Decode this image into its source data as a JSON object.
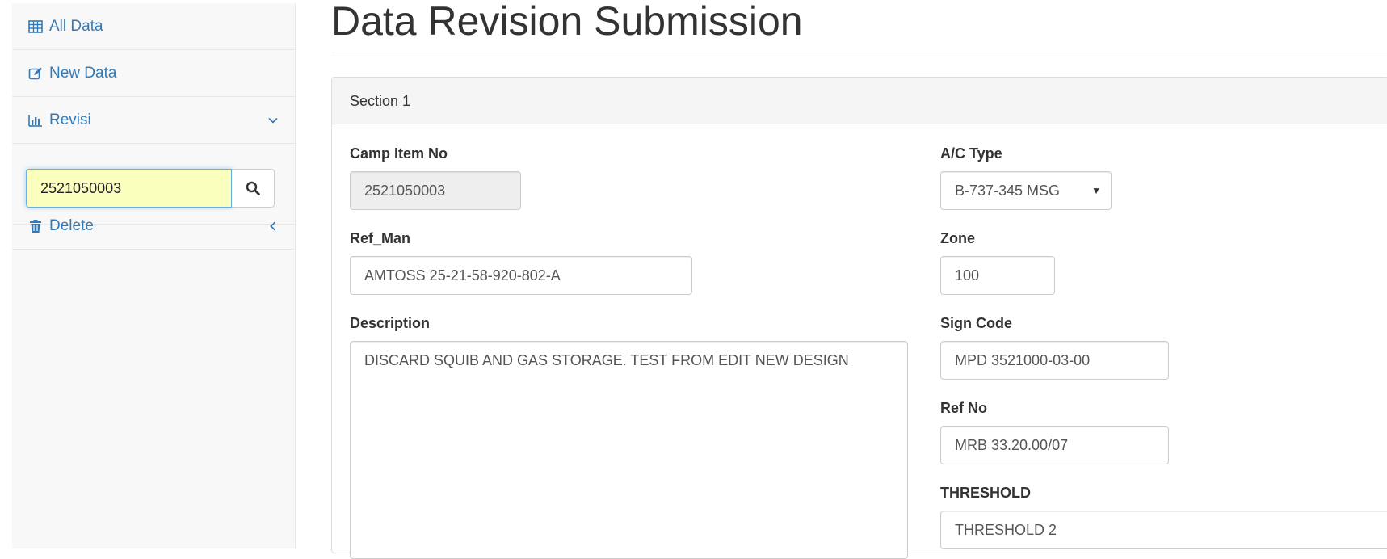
{
  "sidebar": {
    "items": [
      {
        "label": "All Data",
        "icon": "table-icon"
      },
      {
        "label": "New Data",
        "icon": "edit-icon"
      },
      {
        "label": "Revisi",
        "icon": "bar-chart-icon",
        "arrow": "chevron-down-icon"
      },
      {
        "label": "Delete",
        "icon": "trash-icon",
        "arrow": "chevron-left-icon"
      }
    ],
    "search": {
      "value": "2521050003",
      "button_icon": "search-icon"
    }
  },
  "page": {
    "title": "Data Revision Submission"
  },
  "panel": {
    "heading": "Section 1",
    "fields": {
      "camp_item_no": {
        "label": "Camp Item No",
        "value": "2521050003"
      },
      "ref_man": {
        "label": "Ref_Man",
        "value": "AMTOSS 25-21-58-920-802-A"
      },
      "description": {
        "label": "Description",
        "value": "DISCARD SQUIB AND GAS STORAGE. TEST FROM EDIT NEW DESIGN"
      },
      "ac_type": {
        "label": "A/C Type",
        "value": "B-737-345 MSG"
      },
      "zone": {
        "label": "Zone",
        "value": "100"
      },
      "sign_code": {
        "label": "Sign Code",
        "value": "MPD 3521000-03-00"
      },
      "ref_no": {
        "label": "Ref No",
        "value": "MRB 33.20.00/07"
      },
      "threshold": {
        "label": "THRESHOLD",
        "value": "THRESHOLD 2"
      }
    }
  },
  "colors": {
    "link": "#337ab7",
    "sidebar_bg": "#f8f8f8",
    "autofill_bg": "#faffbd",
    "readonly_bg": "#eeeeee",
    "panel_heading_bg": "#f5f5f5"
  }
}
